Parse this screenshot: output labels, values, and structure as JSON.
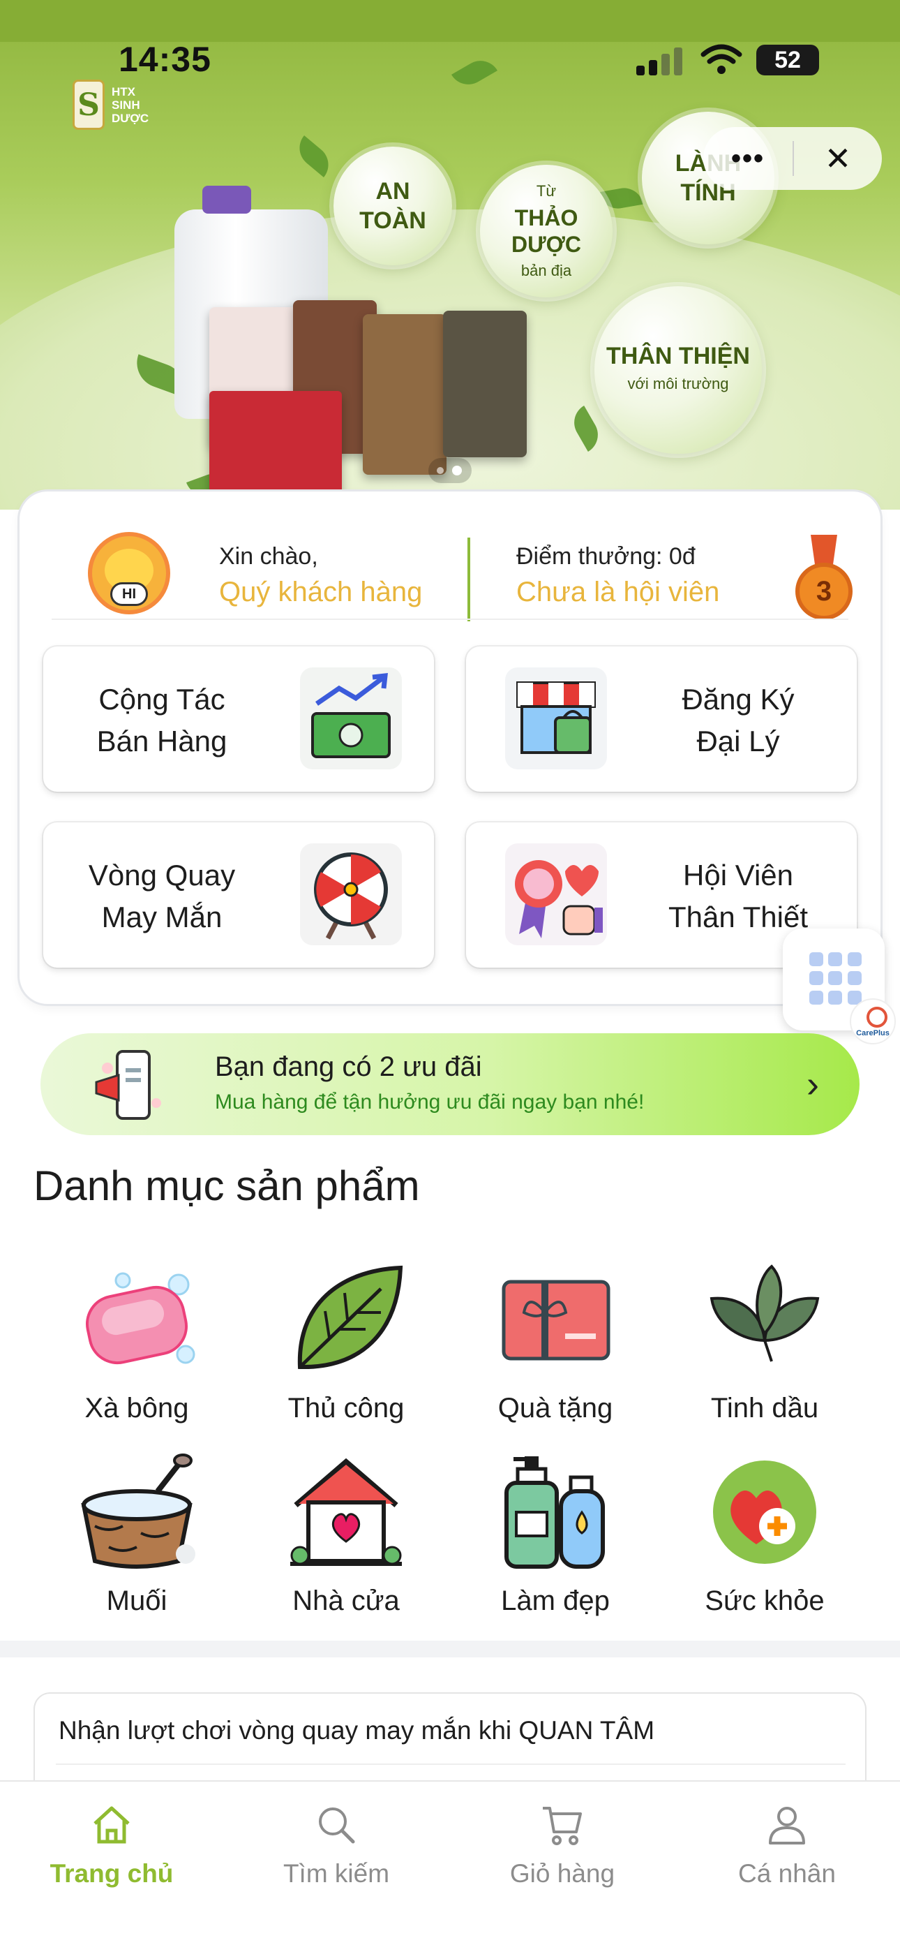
{
  "status_bar": {
    "time": "14:35",
    "battery": "52"
  },
  "banner": {
    "brand": {
      "mark": "S",
      "lines": [
        "HTX",
        "SINH",
        "DƯỢC"
      ]
    },
    "bubbles": [
      {
        "main": "AN\nTOÀN",
        "small": ""
      },
      {
        "top": "Từ",
        "main": "THẢO DƯỢC",
        "small": "bản địa"
      },
      {
        "main": "LÀNH\nTÍNH",
        "small": ""
      },
      {
        "main": "THÂN THIỆN",
        "small": "với môi trường"
      }
    ],
    "capsule": {
      "more": "•••",
      "close": "✕"
    }
  },
  "member": {
    "greeting": "Xin chào,",
    "name": "Quý khách hàng",
    "points_label": "Điểm thưởng: 0đ",
    "tier": "Chưa là hội viên",
    "mascot_text": "HI",
    "medal_number": "3"
  },
  "tiles": [
    {
      "label": "Cộng Tác\nBán Hàng",
      "icon": "money-chart-icon"
    },
    {
      "label": "Đăng Ký\nĐại Lý",
      "icon": "storefront-icon"
    },
    {
      "label": "Vòng Quay\nMay Mắn",
      "icon": "lucky-wheel-icon"
    },
    {
      "label": "Hội Viên\nThân Thiết",
      "icon": "member-badge-icon"
    }
  ],
  "care_plus": {
    "label": "CarePlus"
  },
  "promo": {
    "title": "Bạn đang có 2 ưu đãi",
    "subtitle": "Mua hàng để tận hưởng ưu đãi ngay bạn nhé!",
    "chevron": "›"
  },
  "categories_title": "Danh mục sản phẩm",
  "categories": [
    {
      "label": "Xà bông",
      "icon": "soap-icon"
    },
    {
      "label": "Thủ công",
      "icon": "leaf-icon"
    },
    {
      "label": "Quà tặng",
      "icon": "gift-card-icon"
    },
    {
      "label": "Tinh dầu",
      "icon": "mint-leaves-icon"
    },
    {
      "label": "Muối",
      "icon": "salt-bowl-icon"
    },
    {
      "label": "Nhà cửa",
      "icon": "house-heart-icon"
    },
    {
      "label": "Làm đẹp",
      "icon": "cosmetics-bottles-icon"
    },
    {
      "label": "Sức khỏe",
      "icon": "health-heart-icon"
    }
  ],
  "notice": {
    "text": "Nhận lượt chơi vòng quay may mắn khi QUAN TÂM"
  },
  "tabbar": [
    {
      "label": "Trang chủ",
      "icon": "home-icon",
      "active": true
    },
    {
      "label": "Tìm kiếm",
      "icon": "search-icon",
      "active": false
    },
    {
      "label": "Giỏ hàng",
      "icon": "cart-icon",
      "active": false
    },
    {
      "label": "Cá nhân",
      "icon": "user-icon",
      "active": false
    }
  ],
  "colors": {
    "accent": "#8fbb30",
    "gold": "#e8b53c",
    "promo_green": "#2d8a1e"
  }
}
